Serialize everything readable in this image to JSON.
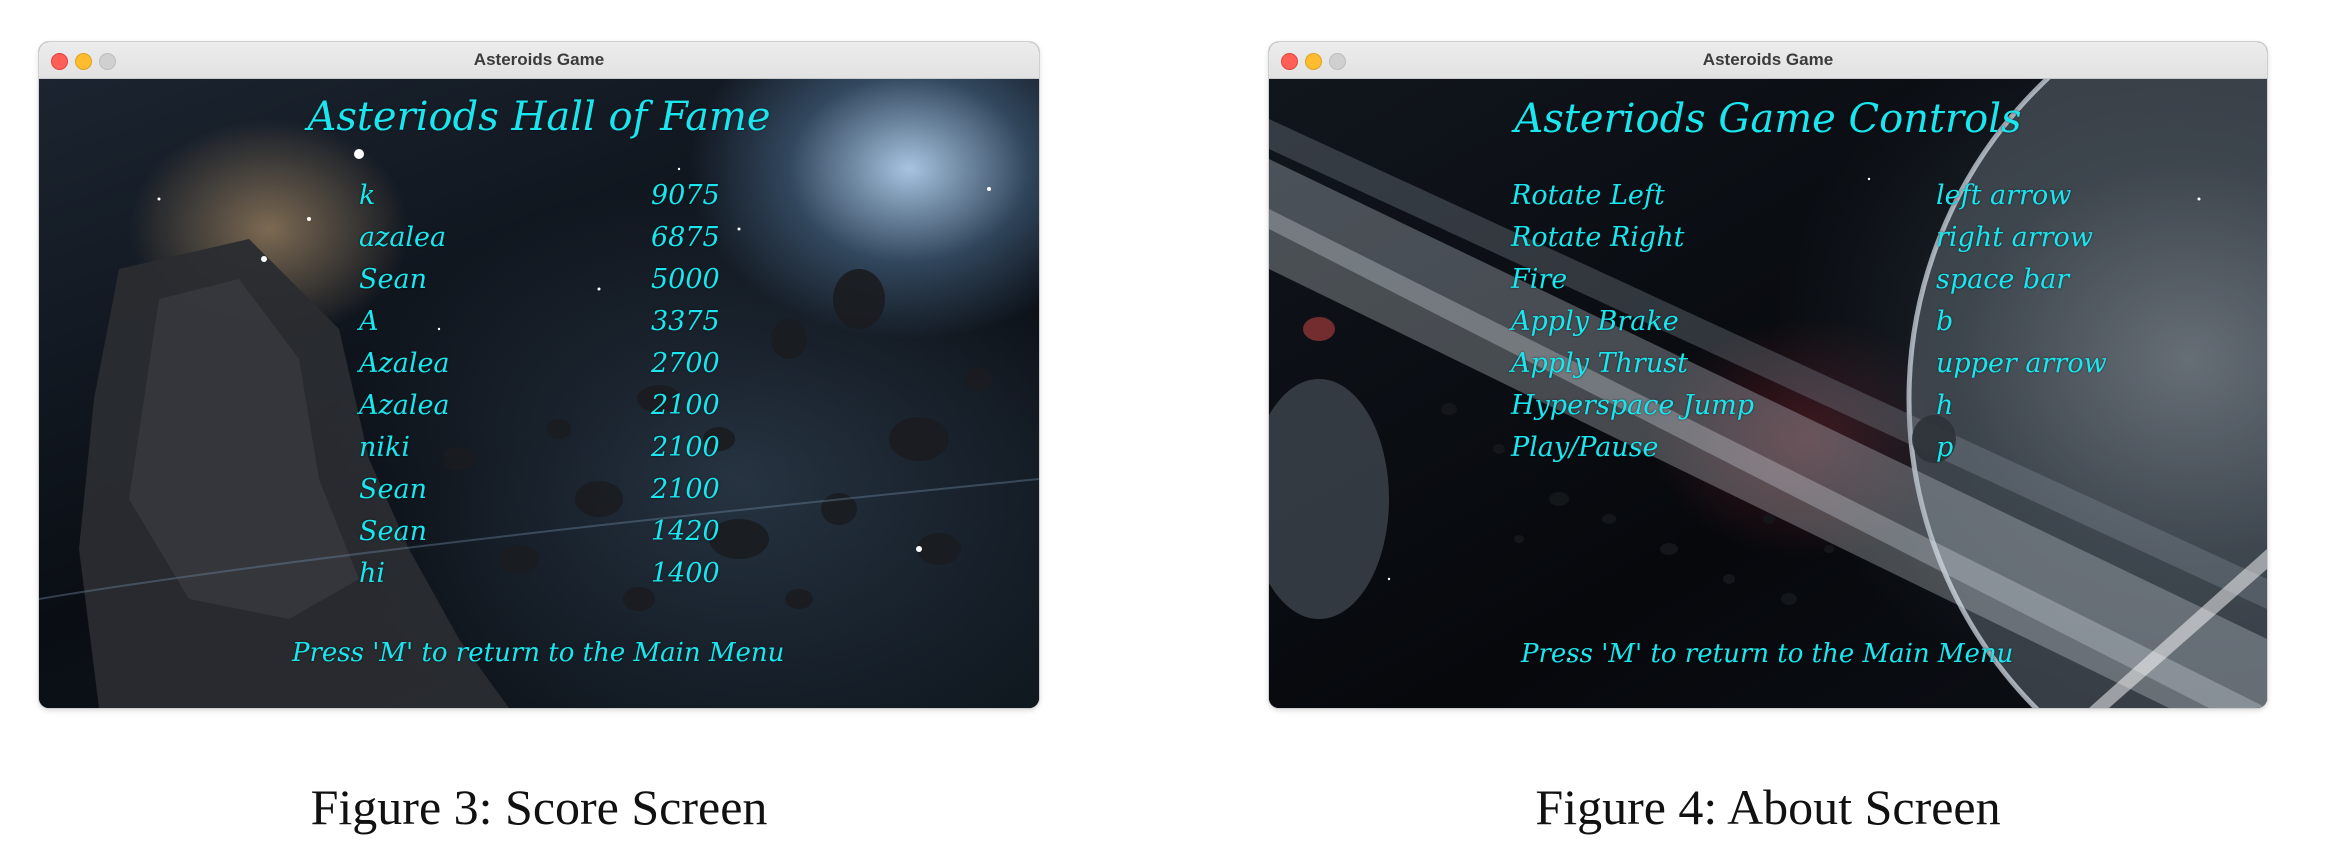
{
  "score_figure": {
    "window_title": "Asteroids Game",
    "heading": "Asteriods Hall of Fame",
    "rows": [
      {
        "name": "k",
        "score": "9075"
      },
      {
        "name": "azalea",
        "score": "6875"
      },
      {
        "name": "Sean",
        "score": "5000"
      },
      {
        "name": "A",
        "score": "3375"
      },
      {
        "name": "Azalea",
        "score": "2700"
      },
      {
        "name": "Azalea",
        "score": "2100"
      },
      {
        "name": "niki",
        "score": "2100"
      },
      {
        "name": "Sean",
        "score": "2100"
      },
      {
        "name": "Sean",
        "score": "1420"
      },
      {
        "name": "hi",
        "score": "1400"
      }
    ],
    "footer": "Press 'M' to return to the Main Menu",
    "caption": "Figure 3: Score Screen"
  },
  "about_figure": {
    "window_title": "Asteroids Game",
    "heading": "Asteriods Game Controls",
    "rows": [
      {
        "action": "Rotate Left",
        "key": "left arrow"
      },
      {
        "action": "Rotate Right",
        "key": "right arrow"
      },
      {
        "action": "Fire",
        "key": "space bar"
      },
      {
        "action": "Apply Brake",
        "key": "b"
      },
      {
        "action": "Apply Thrust",
        "key": "upper arrow"
      },
      {
        "action": "Hyperspace Jump",
        "key": "h"
      },
      {
        "action": "Play/Pause",
        "key": "p"
      }
    ],
    "footer": "Press 'M' to return to the Main Menu",
    "caption": "Figure 4: About Screen"
  },
  "colors": {
    "overlay_text": "#19e6ee",
    "close_button": "#ff5f57",
    "minimize_button": "#febc2e",
    "zoom_button": "#d0d0d0"
  }
}
